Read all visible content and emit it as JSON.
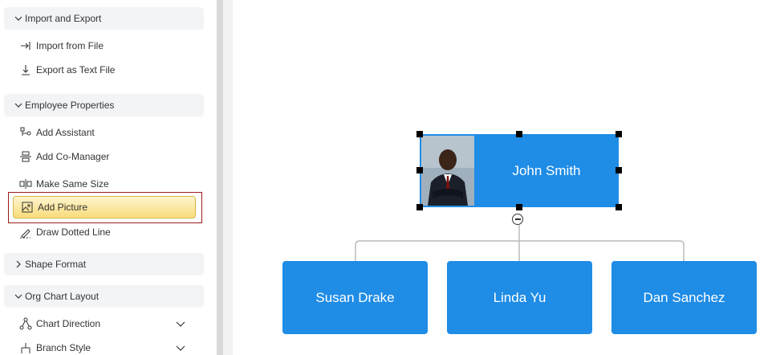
{
  "sidebar": {
    "sections": [
      {
        "label": "Import and Export",
        "expanded": true
      },
      {
        "label": "Employee Properties",
        "expanded": true
      },
      {
        "label": "Shape Format",
        "expanded": false
      },
      {
        "label": "Org Chart Layout",
        "expanded": true
      }
    ],
    "items": {
      "import_from_file": "Import from File",
      "export_as_text_file": "Export as Text File",
      "add_assistant": "Add Assistant",
      "add_co_manager": "Add Co-Manager",
      "make_same_size": "Make Same Size",
      "add_picture": "Add Picture",
      "draw_dotted_line": "Draw Dotted Line",
      "chart_direction": "Chart Direction",
      "branch_style": "Branch Style"
    }
  },
  "org_chart": {
    "root": {
      "name": "John Smith",
      "has_picture": true,
      "selected": true
    },
    "children": [
      {
        "name": "Susan Drake"
      },
      {
        "name": "Linda Yu"
      },
      {
        "name": "Dan Sanchez"
      }
    ],
    "node_color": "#1f8ce6"
  },
  "colors": {
    "highlight_outline": "#9b1c1c",
    "highlight_fill": "#f8dc7a"
  }
}
